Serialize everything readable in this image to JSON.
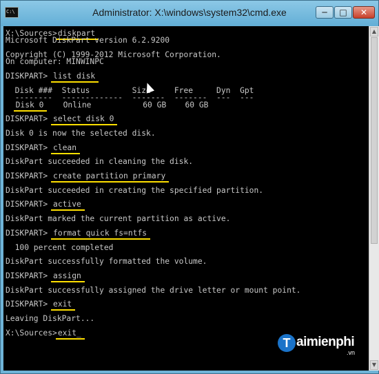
{
  "window": {
    "icon_text": "C:\\",
    "title": "Administrator: X:\\windows\\system32\\cmd.exe",
    "minimize_symbol": "─",
    "maximize_symbol": "□",
    "close_symbol": "✕"
  },
  "console_lines": [
    {
      "text": "X:\\Sources>",
      "highlight": "diskpart"
    },
    {
      "text": "Microsoft DiskPart version 6.2.9200"
    },
    {
      "text": ""
    },
    {
      "text": "Copyright (C) 1999-2012 Microsoft Corporation."
    },
    {
      "text": "On computer: MINWINPC"
    },
    {
      "text": ""
    },
    {
      "text": "DISKPART> ",
      "highlight": "list disk"
    },
    {
      "text": ""
    },
    {
      "text": "  Disk ###  Status         Size     Free     Dyn  Gpt"
    },
    {
      "text": "  --------  -------------  -------  -------  ---  ---"
    },
    {
      "text": "  ",
      "highlight": "Disk 0",
      "after": "    Online           60 GB    60 GB"
    },
    {
      "text": ""
    },
    {
      "text": "DISKPART> ",
      "highlight": "select disk 0"
    },
    {
      "text": ""
    },
    {
      "text": "Disk 0 is now the selected disk."
    },
    {
      "text": ""
    },
    {
      "text": "DISKPART> ",
      "highlight": "clean"
    },
    {
      "text": ""
    },
    {
      "text": "DiskPart succeeded in cleaning the disk."
    },
    {
      "text": ""
    },
    {
      "text": "DISKPART> ",
      "highlight": "create partition primary"
    },
    {
      "text": ""
    },
    {
      "text": "DiskPart succeeded in creating the specified partition."
    },
    {
      "text": ""
    },
    {
      "text": "DISKPART> ",
      "highlight": "active"
    },
    {
      "text": ""
    },
    {
      "text": "DiskPart marked the current partition as active."
    },
    {
      "text": ""
    },
    {
      "text": "DISKPART> ",
      "highlight": "format quick fs=ntfs"
    },
    {
      "text": ""
    },
    {
      "text": "  100 percent completed"
    },
    {
      "text": ""
    },
    {
      "text": "DiskPart successfully formatted the volume."
    },
    {
      "text": ""
    },
    {
      "text": "DISKPART> ",
      "highlight": "assign"
    },
    {
      "text": ""
    },
    {
      "text": "DiskPart successfully assigned the drive letter or mount point."
    },
    {
      "text": ""
    },
    {
      "text": "DISKPART> ",
      "highlight": "exit"
    },
    {
      "text": ""
    },
    {
      "text": "Leaving DiskPart..."
    },
    {
      "text": ""
    },
    {
      "text": "X:\\Sources>",
      "highlight": "exit_"
    }
  ],
  "watermark": {
    "glyph": "T",
    "text": "aimienphi",
    "suffix": ".vn"
  },
  "colors": {
    "console_bg": "#000000",
    "console_text": "#c8c8c8",
    "highlight_underline": "#ffe000",
    "watermark_blue": "#1a73c9"
  },
  "icons": {
    "window_icon": "cmd-icon",
    "minimize": "minimize-icon",
    "maximize": "maximize-icon",
    "close": "close-icon"
  }
}
